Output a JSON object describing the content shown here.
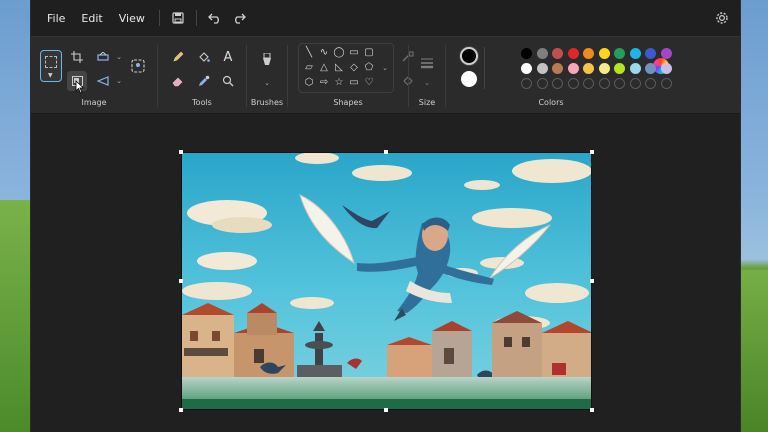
{
  "menu": {
    "file": "File",
    "edit": "Edit",
    "view": "View"
  },
  "groups": {
    "image": "Image",
    "tools": "Tools",
    "brushes": "Brushes",
    "shapes": "Shapes",
    "size": "Size",
    "colors": "Colors"
  },
  "tools": {
    "text_icon": "A"
  },
  "colors": {
    "primary": "#000000",
    "secondary": "#ffffff",
    "palette_row1": [
      "#000000",
      "#7f7f7f",
      "#c0504d",
      "#e0252b",
      "#f08a1c",
      "#ffd41c",
      "#22a05a",
      "#1fb4e6",
      "#3a5bc9",
      "#a346c9"
    ],
    "palette_row2": [
      "#ffffff",
      "#c3c3c3",
      "#b97a56",
      "#f4a7b9",
      "#f5c24a",
      "#f4ec86",
      "#b5e61d",
      "#99d9ea",
      "#7092be",
      "#c8bfe7"
    ]
  }
}
